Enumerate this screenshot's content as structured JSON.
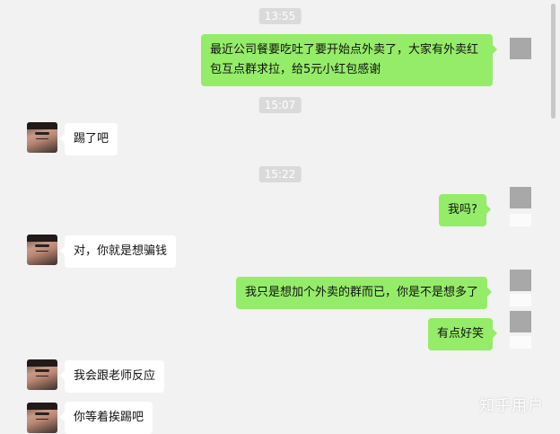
{
  "timestamps": [
    "13:55",
    "15:07",
    "15:22"
  ],
  "messages": [
    {
      "side": "out",
      "lines": [
        "最近公司餐要吃吐了要开始点外卖了，大家有外卖红",
        "包互点群求拉，给5元小红包感谢"
      ]
    },
    {
      "side": "in",
      "text": "踢了吧"
    },
    {
      "side": "out",
      "text": "我吗?"
    },
    {
      "side": "in",
      "text": "对，你就是想骗钱"
    },
    {
      "side": "out",
      "text": "我只是想加个外卖的群而已，你是不是想多了"
    },
    {
      "side": "out",
      "text": "有点好笑"
    },
    {
      "side": "in",
      "text": "我会跟老师反应"
    },
    {
      "side": "in",
      "text": "你等着挨踢吧"
    }
  ],
  "watermark": "知乎用户"
}
